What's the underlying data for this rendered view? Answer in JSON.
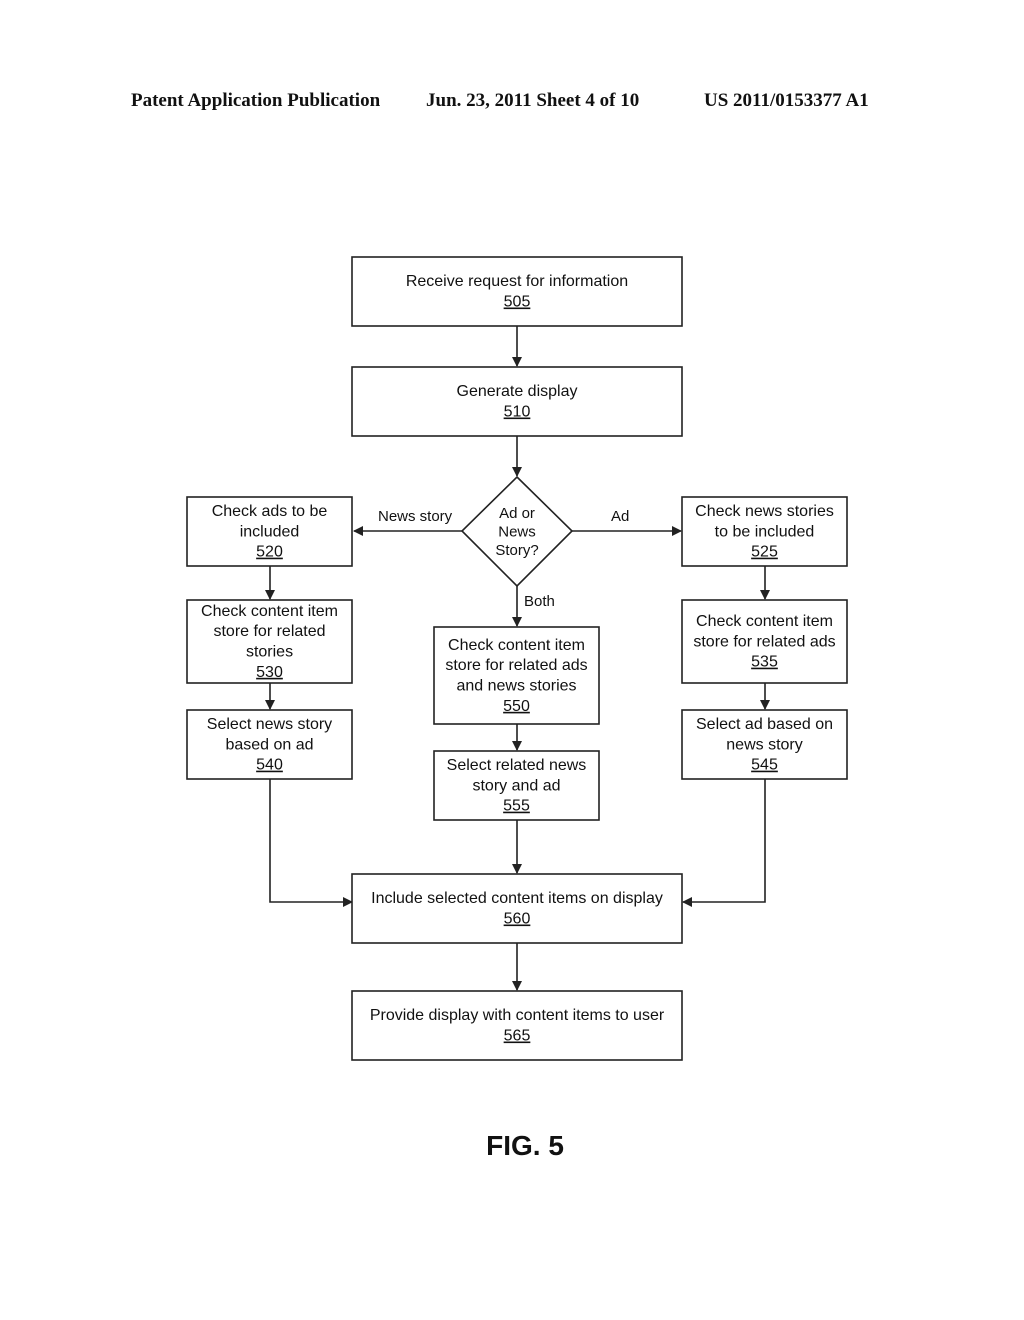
{
  "header": {
    "publication": "Patent Application Publication",
    "date_sheet": "Jun. 23, 2011  Sheet 4 of 10",
    "number": "US 2011/0153377 A1"
  },
  "figure_label": "FIG. 5",
  "nodes": {
    "n505": {
      "lines": [
        "Receive request for information"
      ],
      "ref": "505"
    },
    "n510": {
      "lines": [
        "Generate display"
      ],
      "ref": "510"
    },
    "decision": {
      "lines": [
        "Ad or",
        "News",
        "Story?"
      ]
    },
    "n520": {
      "lines": [
        "Check ads to be",
        "included"
      ],
      "ref": "520"
    },
    "n525": {
      "lines": [
        "Check news stories",
        "to be included"
      ],
      "ref": "525"
    },
    "n530": {
      "lines": [
        "Check content item",
        "store for related",
        "stories"
      ],
      "ref": "530"
    },
    "n535": {
      "lines": [
        "Check content item",
        "store for related ads"
      ],
      "ref": "535"
    },
    "n540": {
      "lines": [
        "Select news story",
        "based on ad"
      ],
      "ref": "540"
    },
    "n545": {
      "lines": [
        "Select ad based on",
        "news story"
      ],
      "ref": "545"
    },
    "n550": {
      "lines": [
        "Check content item",
        "store for related ads",
        "and news stories"
      ],
      "ref": "550"
    },
    "n555": {
      "lines": [
        "Select related news",
        "story and ad"
      ],
      "ref": "555"
    },
    "n560": {
      "lines": [
        "Include selected content items on display"
      ],
      "ref": "560"
    },
    "n565": {
      "lines": [
        "Provide display with content items to user"
      ],
      "ref": "565"
    }
  },
  "edge_labels": {
    "news_story": "News story",
    "ad": "Ad",
    "both": "Both"
  }
}
